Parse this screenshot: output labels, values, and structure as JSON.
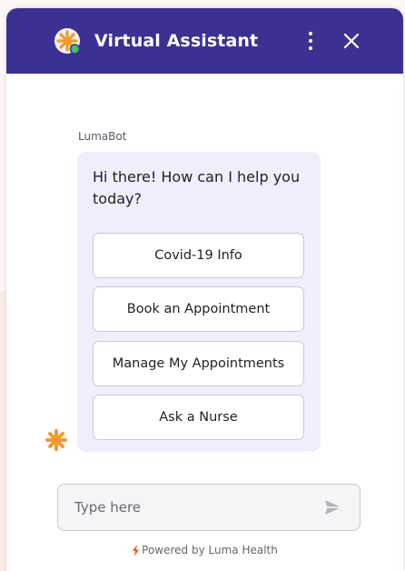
{
  "header": {
    "title": "Virtual Assistant",
    "logo_icon": "luma-sun-logo-icon",
    "menu_icon": "more-vertical-icon",
    "close_icon": "close-icon",
    "background": "#3a3193"
  },
  "chat": {
    "sender": "LumaBot",
    "message": "Hi there! How can I help you today?",
    "options": [
      "Covid-19 Info",
      "Book an Appointment",
      "Manage My Appointments",
      "Ask a Nurse"
    ],
    "bubble_color": "#efeefc"
  },
  "composer": {
    "placeholder": "Type here",
    "send_icon": "send-icon"
  },
  "footer": {
    "powered_by": "Powered by Luma Health",
    "icon": "bolt-icon",
    "accent": "#f05a28"
  }
}
